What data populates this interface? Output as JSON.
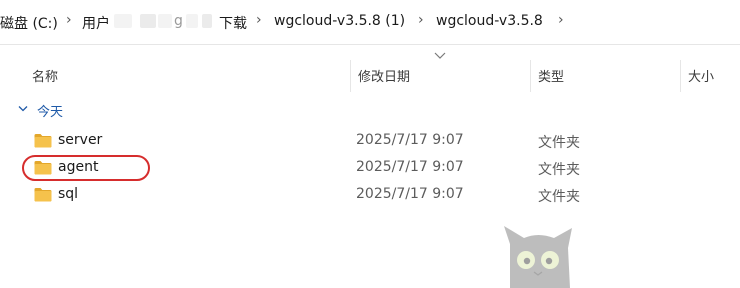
{
  "address": {
    "crumbs": [
      "磁盘 (C:)",
      "用户",
      "下载",
      "wgcloud-v3.5.8 (1)",
      "wgcloud-v3.5.8"
    ],
    "obscured_fragment": "g",
    "separator_glyph": "›",
    "dropdown_glyph": "⌄"
  },
  "columns": {
    "name": "名称",
    "date": "修改日期",
    "type": "类型",
    "size": "大小"
  },
  "group": {
    "label": "今天"
  },
  "files": [
    {
      "name": "server",
      "date": "2025/7/17 9:07",
      "type": "文件夹"
    },
    {
      "name": "agent",
      "date": "2025/7/17 9:07",
      "type": "文件夹",
      "highlighted": true
    },
    {
      "name": "sql",
      "date": "2025/7/17 9:07",
      "type": "文件夹"
    }
  ],
  "colors": {
    "folder": "#f5c24c",
    "folder_tab": "#e3a72b",
    "highlight": "#d62d2d",
    "group_label": "#1f5aa8"
  },
  "icons": {
    "folder": "folder-icon",
    "chevron": "chevron-down-icon",
    "separator": "chevron-right-icon"
  }
}
